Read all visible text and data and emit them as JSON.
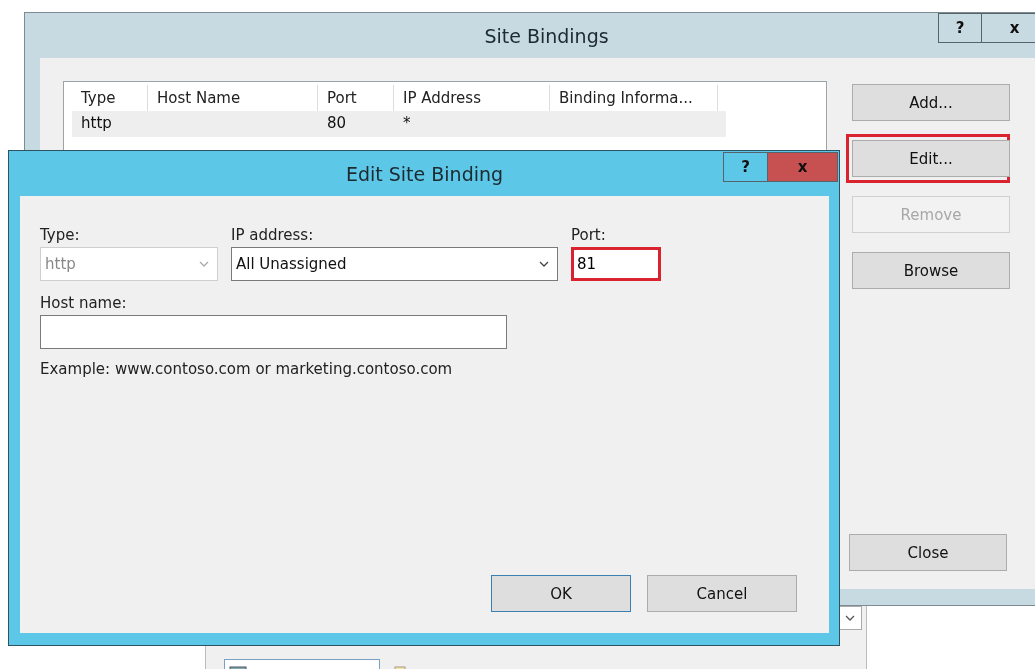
{
  "site_bindings": {
    "title": "Site Bindings",
    "title_buttons": [
      {
        "label": "?",
        "kind": "help"
      },
      {
        "label": "x",
        "kind": "close"
      }
    ],
    "table": {
      "columns": [
        "Type",
        "Host Name",
        "Port",
        "IP Address",
        "Binding Informa..."
      ],
      "rows": [
        {
          "type": "http",
          "port": "80",
          "ip_address": "*"
        }
      ]
    },
    "buttons": [
      {
        "label": "Add...",
        "disabled": false,
        "highlighted": false
      },
      {
        "label": "Edit...",
        "disabled": false,
        "highlighted": true
      },
      {
        "label": "Remove",
        "disabled": true,
        "highlighted": false
      },
      {
        "label": "Browse",
        "disabled": false,
        "highlighted": false
      }
    ],
    "close_button": {
      "label": "Close"
    }
  },
  "edit_site_binding": {
    "title": "Edit Site Binding",
    "title_buttons": [
      {
        "label": "?",
        "kind": "help"
      },
      {
        "label": "x",
        "kind": "close"
      }
    ],
    "type": {
      "label": "Type:",
      "value": "http",
      "disabled": true
    },
    "ip_address": {
      "label": "IP address:",
      "value": "All Unassigned",
      "disabled": false
    },
    "port": {
      "label": "Port:",
      "value": "81",
      "highlighted": true
    },
    "host_name": {
      "label": "Host name:"
    },
    "example": "Example: www.contoso.com or marketing.contoso.com",
    "buttons": [
      {
        "label": "OK",
        "default": true
      },
      {
        "label": "Cancel",
        "default": false
      }
    ]
  }
}
